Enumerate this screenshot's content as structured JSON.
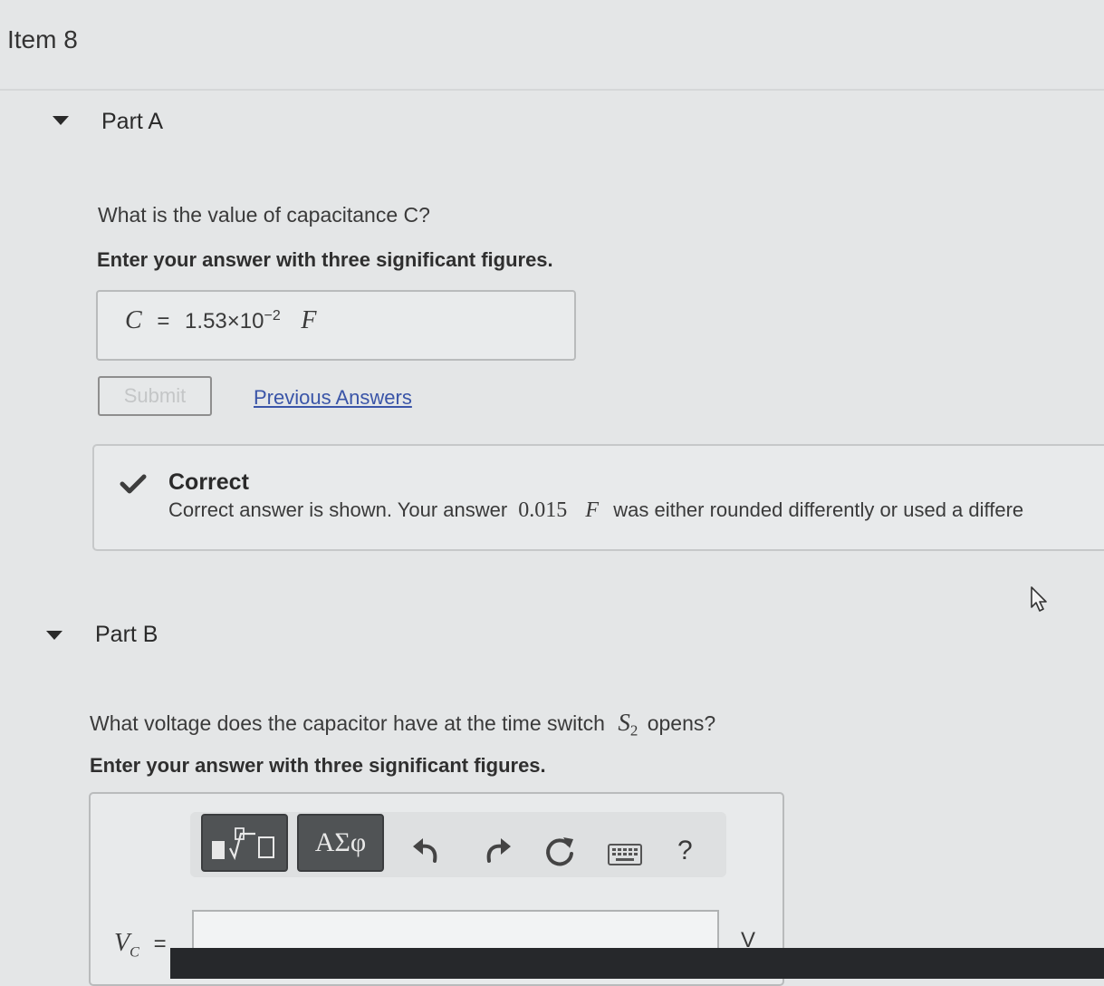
{
  "item": {
    "title": "Item 8"
  },
  "part_a": {
    "title": "Part A",
    "question": "What is the value of capacitance C?",
    "instruction": "Enter your answer with three significant figures.",
    "answer": {
      "variable": "C",
      "equals": "=",
      "mantissa": "1.53×10",
      "exponent": "−2",
      "unit": "F"
    },
    "submit_label": "Submit",
    "previous_answers_label": "Previous Answers",
    "feedback": {
      "title": "Correct",
      "text_before": "Correct answer is shown. Your answer",
      "value": "0.015",
      "unit": "F",
      "text_after": "was either rounded differently or used a differe"
    }
  },
  "part_b": {
    "title": "Part B",
    "question_before": "What voltage does the capacitor have at the time switch",
    "switch_symbol": "S",
    "switch_subscript": "2",
    "question_after": "opens?",
    "instruction": "Enter your answer with three significant figures.",
    "toolbar": {
      "greek_label": "ΑΣφ",
      "help_label": "?"
    },
    "input_label": "V",
    "input_label_sub": "C",
    "input_equals": "=",
    "input_value": "",
    "unit": "V"
  },
  "colors": {
    "link": "#3a55a8",
    "check": "#3d3d3d",
    "toolbar_button": "#505355"
  }
}
